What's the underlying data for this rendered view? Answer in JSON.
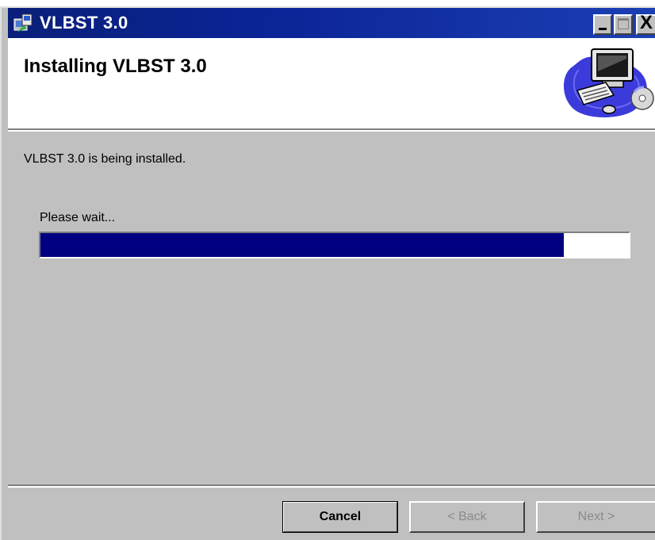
{
  "window": {
    "title": "VLBST 3.0",
    "minimize_label": "_",
    "close_label": "X"
  },
  "header": {
    "title": "Installing VLBST 3.0"
  },
  "body": {
    "status": "VLBST 3.0 is being installed.",
    "wait_label": "Please wait...",
    "progress_fraction": 0.89
  },
  "footer": {
    "cancel_label": "Cancel",
    "back_label": "< Back",
    "next_label": "Next >"
  },
  "colors": {
    "titlebar": "#0b2496",
    "progress_fill": "#000080",
    "dialog_bg": "#c0c0c0"
  },
  "icons": {
    "app_icon": "installer-icon",
    "header_art": "computer-cd-icon"
  }
}
